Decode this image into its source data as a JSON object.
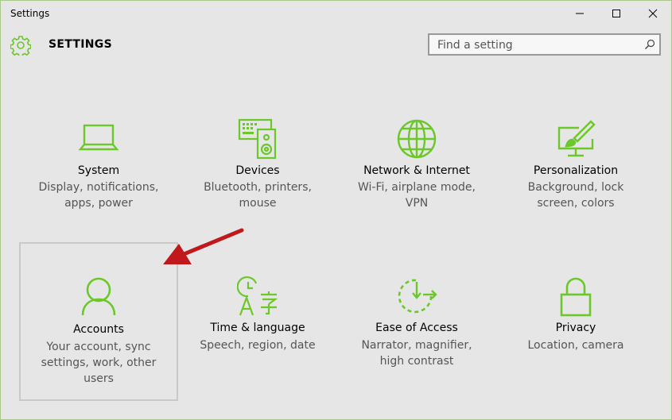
{
  "window": {
    "title": "Settings",
    "controls": [
      "minimize-icon",
      "maximize-icon",
      "close-icon"
    ]
  },
  "header": {
    "icon": "gear-icon",
    "title": "SETTINGS",
    "accent_color": "#6cc82a"
  },
  "search": {
    "placeholder": "Find a setting",
    "icon": "search-icon"
  },
  "categories": [
    {
      "name": "System",
      "desc_lines": [
        "Display, notifications,",
        "apps, power"
      ],
      "icon": "laptop-icon"
    },
    {
      "name": "Devices",
      "desc_lines": [
        "Bluetooth, printers,",
        "mouse"
      ],
      "icon": "devices-icon"
    },
    {
      "name": "Network & Internet",
      "desc_lines": [
        "Wi-Fi, airplane mode,",
        "VPN"
      ],
      "icon": "globe-icon"
    },
    {
      "name": "Personalization",
      "desc_lines": [
        "Background, lock",
        "screen, colors"
      ],
      "icon": "personalization-icon"
    },
    {
      "name": "Accounts",
      "desc_lines": [
        "Your account, sync",
        "settings, work, other",
        "users"
      ],
      "icon": "person-icon",
      "selected": true
    },
    {
      "name": "Time & language",
      "desc_lines": [
        "Speech, region, date"
      ],
      "icon": "time-language-icon"
    },
    {
      "name": "Ease of Access",
      "desc_lines": [
        "Narrator, magnifier,",
        "high contrast"
      ],
      "icon": "ease-of-access-icon"
    },
    {
      "name": "Privacy",
      "desc_lines": [
        "Location, camera"
      ],
      "icon": "lock-icon"
    }
  ],
  "annotation": {
    "arrow_color": "#c0181b",
    "icon": "red-arrow-icon"
  }
}
